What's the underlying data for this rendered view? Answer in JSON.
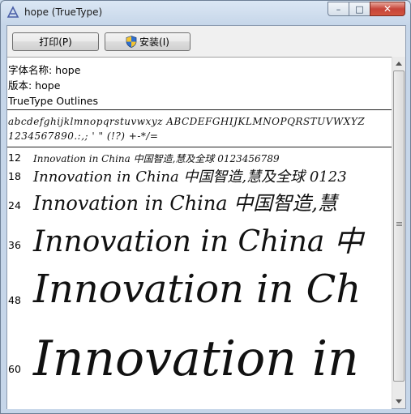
{
  "window": {
    "title": "hope (TrueType)",
    "controls": {
      "minimize": "–",
      "maximize": "□",
      "close": "✕"
    }
  },
  "toolbar": {
    "print_label": "打印(P)",
    "install_label": "安装(I)"
  },
  "font_info": {
    "name_line": "字体名称: hope",
    "version_line": "版本: hope",
    "outline_line": "TrueType Outlines"
  },
  "charset": {
    "lowercase_line": "abcdefghijklmnopqrstuvwxyz ABCDEFGHIJKLMNOPQRSTUVWXYZ",
    "digits_line": "1234567890.:,; ' \" (!?) +-*/="
  },
  "samples": [
    {
      "size": "12",
      "text": "Innovation in China 中国智造,慧及全球 0123456789"
    },
    {
      "size": "18",
      "text": "Innovation in China 中国智造,慧及全球 0123"
    },
    {
      "size": "24",
      "text": "Innovation in China 中国智造,慧"
    },
    {
      "size": "36",
      "text": "Innovation in China 中"
    },
    {
      "size": "48",
      "text": "Innovation in Ch"
    },
    {
      "size": "60",
      "text": "Innovation in"
    }
  ]
}
